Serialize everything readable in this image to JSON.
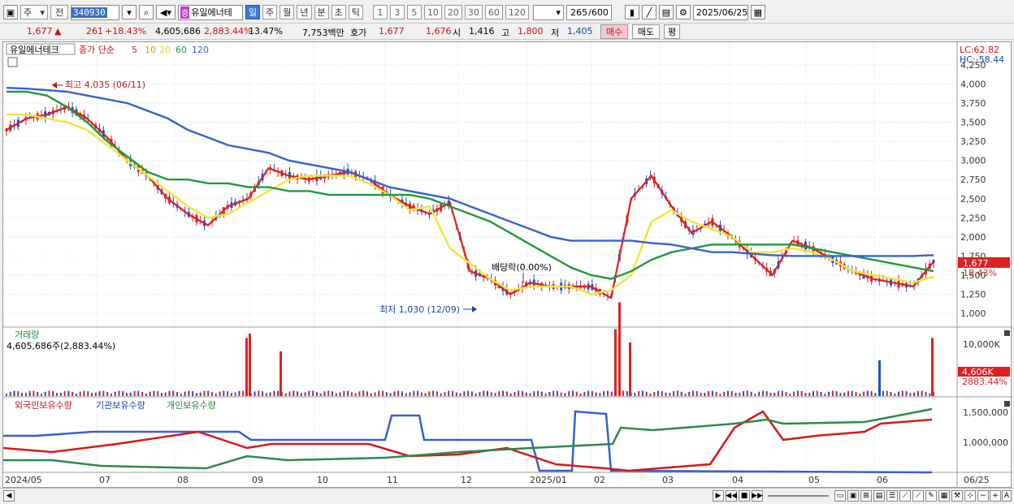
{
  "toolbar": {
    "period_sel": "주",
    "prev": "전",
    "code": "340930",
    "name": "유일에너테",
    "periods": [
      "일",
      "주",
      "월",
      "년",
      "분",
      "초",
      "틱"
    ],
    "active_period": "일",
    "nums": [
      "1",
      "3",
      "5",
      "10",
      "20",
      "30",
      "60",
      "120"
    ],
    "count": "265",
    "count_total": "/600",
    "date": "2025/06/25"
  },
  "quote": {
    "price": "1,677",
    "arrow": "▲",
    "change": "261",
    "rate": "+18.43%",
    "volume": "4,605,686",
    "vol_ratio": "2,883.44%",
    "turnover_rate": "13.47%",
    "amount": "7,753백만",
    "hoga_label": "호가",
    "ask": "1,677",
    "bid": "1,676",
    "open_label": "시",
    "open": "1,416",
    "high_label": "고",
    "high": "1,800",
    "low_label": "저",
    "low": "1,405",
    "buy": "매수",
    "sell": "매도",
    "avg": "평"
  },
  "legend": {
    "stock": "유일에너테크",
    "type": "종가 단순",
    "ma": [
      "5",
      "10",
      "20",
      "60",
      "120"
    ]
  },
  "colors": {
    "ma5": "#e02020",
    "ma10": "#f08c1e",
    "ma20": "#f2e634",
    "ma60": "#1e9a3c",
    "ma120": "#3560d8",
    "up": "#e02020",
    "down": "#2050d0"
  },
  "price_axis": [
    "4,250",
    "4,000",
    "3,750",
    "3,500",
    "3,250",
    "3,000",
    "2,750",
    "2,500",
    "2,250",
    "2,000",
    "1,750",
    "1,500",
    "1,250",
    "1,000"
  ],
  "annotations": {
    "high": "최고 4,035 (06/11)",
    "low": "최저 1,030 (12/09)",
    "dividend": "배당락(0.00%)"
  },
  "right_badges": {
    "lc": "LC:62.82",
    "hc": "HC:-58.44",
    "price": "1,677",
    "rate": "18.43%",
    "vol": "4,606K",
    "vol_rate": "2883.44%"
  },
  "volume_panel": {
    "title": "거래량",
    "value": "4,605,686주(2,883.44%)",
    "axis": "10,000K"
  },
  "holding_panel": {
    "foreign": "외국인보유수량",
    "inst": "기관보유수량",
    "indiv": "개인보유수량",
    "axis": [
      "1,500,000",
      "1,000,000"
    ]
  },
  "x_axis": [
    "2024/05",
    "07",
    "08",
    "09",
    "10",
    "11",
    "12",
    "2025/01",
    "02",
    "03",
    "04",
    "05",
    "06",
    "06/25"
  ],
  "chart_data": {
    "type": "candlestick",
    "series": [
      {
        "name": "5",
        "values": [
          3400,
          3550,
          3600,
          3700,
          3550,
          3300,
          3000,
          2800,
          2500,
          2300,
          2150,
          2400,
          2500,
          2900,
          2800,
          2750,
          2800,
          2850,
          2750,
          2550,
          2400,
          2300,
          2450,
          1550,
          1450,
          1250,
          1400,
          1350,
          1350,
          1350,
          1200,
          2500,
          2800,
          2400,
          2050,
          2200,
          2000,
          1750,
          1500,
          1950,
          1850,
          1700,
          1550,
          1450,
          1400,
          1350,
          1677
        ]
      },
      {
        "name": "20",
        "values": [
          3600,
          3600,
          3550,
          3500,
          3400,
          3200,
          3000,
          2800,
          2600,
          2400,
          2250,
          2300,
          2450,
          2600,
          2750,
          2800,
          2800,
          2800,
          2700,
          2550,
          2350,
          2400,
          1850,
          1650,
          1450,
          1300,
          1350,
          1350,
          1350,
          1250,
          1300,
          1500,
          2200,
          2350,
          2200,
          2100,
          2000,
          1800,
          1800,
          1850,
          1800,
          1700,
          1550,
          1500,
          1450,
          1400,
          1480
        ]
      },
      {
        "name": "60",
        "values": [
          3900,
          3900,
          3850,
          3700,
          3500,
          3250,
          3050,
          2850,
          2750,
          2750,
          2700,
          2700,
          2650,
          2650,
          2600,
          2600,
          2550,
          2550,
          2550,
          2550,
          2550,
          2500,
          2400,
          2300,
          2200,
          2050,
          1900,
          1750,
          1600,
          1500,
          1450,
          1550,
          1700,
          1800,
          1850,
          1900,
          1900,
          1900,
          1900,
          1900,
          1850,
          1800,
          1750,
          1700,
          1650,
          1600,
          1550
        ]
      },
      {
        "name": "120",
        "values": [
          3950,
          3940,
          3920,
          3900,
          3850,
          3800,
          3750,
          3650,
          3550,
          3400,
          3300,
          3200,
          3150,
          3100,
          3000,
          2950,
          2900,
          2850,
          2750,
          2650,
          2600,
          2550,
          2500,
          2400,
          2300,
          2200,
          2100,
          2000,
          1950,
          1950,
          1950,
          1950,
          1920,
          1900,
          1850,
          1800,
          1800,
          1780,
          1760,
          1750,
          1750,
          1750,
          1750,
          1750,
          1750,
          1750,
          1760
        ]
      }
    ],
    "volume_spikes": [
      {
        "x": "2024/08",
        "v": 6.5
      },
      {
        "x": "2024/09",
        "v": 7
      },
      {
        "x": "2024/09",
        "v": 5
      },
      {
        "x": "2025/02",
        "v": 7.5
      },
      {
        "x": "2025/02",
        "v": 10.5
      },
      {
        "x": "2025/02",
        "v": 6
      },
      {
        "x": "2025/06",
        "v": 4
      },
      {
        "x": "2025/06/25",
        "v": 6.5
      }
    ]
  }
}
